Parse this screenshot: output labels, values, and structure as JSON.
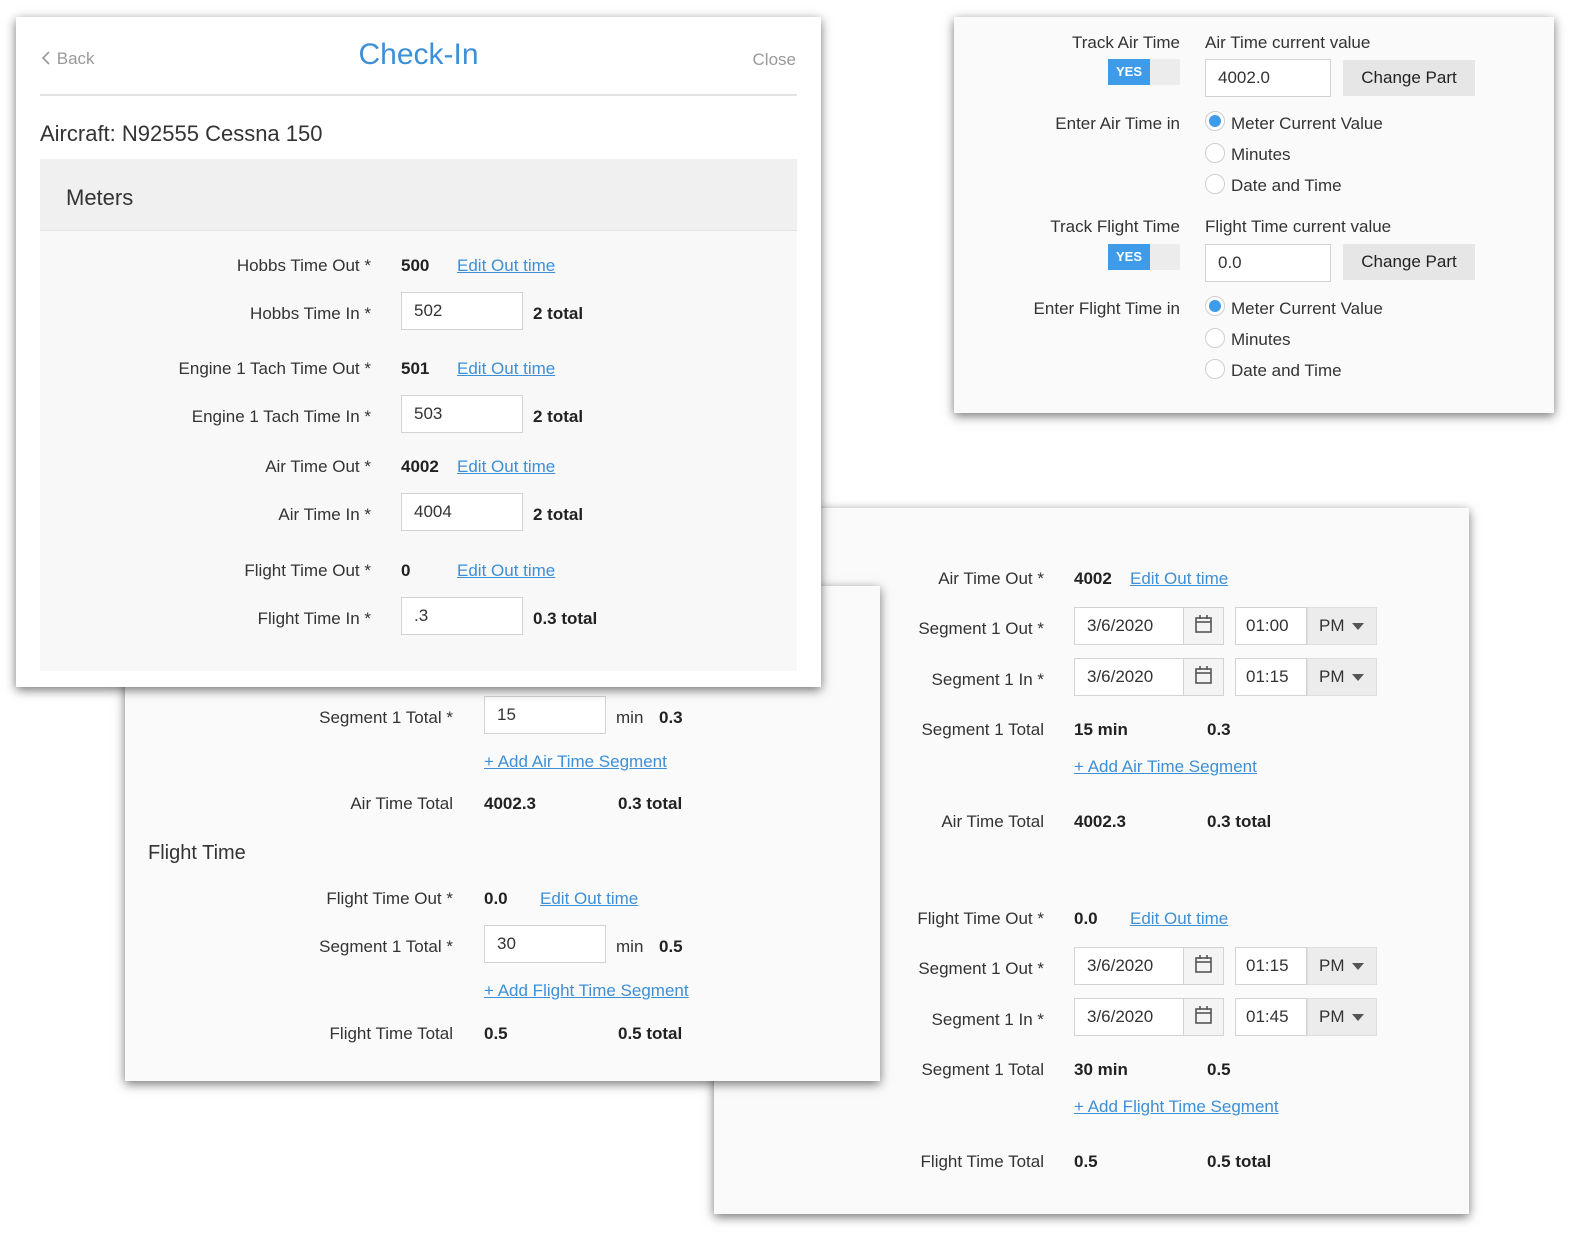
{
  "checkin": {
    "back": "Back",
    "title": "Check-In",
    "close": "Close",
    "aircraft": "Aircraft: N92555 Cessna 150",
    "section": "Meters",
    "rows": {
      "hobbs_out_label": "Hobbs Time Out *",
      "hobbs_out_value": "500",
      "hobbs_in_label": "Hobbs Time In *",
      "hobbs_in_value": "502",
      "hobbs_total": "2 total",
      "tach_out_label": "Engine 1 Tach Time Out *",
      "tach_out_value": "501",
      "tach_in_label": "Engine 1 Tach Time In *",
      "tach_in_value": "503",
      "tach_total": "2 total",
      "air_out_label": "Air Time Out *",
      "air_out_value": "4002",
      "air_in_label": "Air Time In *",
      "air_in_value": "4004",
      "air_total": "2 total",
      "flight_out_label": "Flight Time Out *",
      "flight_out_value": "0",
      "flight_in_label": "Flight Time In *",
      "flight_in_value": ".3",
      "flight_total": "0.3 total"
    },
    "edit_out": "Edit Out time"
  },
  "settings": {
    "track_air_label": "Track Air Time",
    "air_current_label": "Air Time current value",
    "toggle_yes": "YES",
    "air_current_value": "4002.0",
    "change_part": "Change Part",
    "enter_air_label": "Enter Air Time in",
    "options": [
      "Meter Current Value",
      "Minutes",
      "Date and Time"
    ],
    "track_flight_label": "Track Flight Time",
    "flight_current_label": "Flight Time current value",
    "flight_current_value": "0.0",
    "enter_flight_label": "Enter Flight Time in"
  },
  "minutes_panel": {
    "seg1_total_label": "Segment 1 Total *",
    "air_seg_value": "15",
    "min": "min",
    "air_seg_hours": "0.3",
    "add_air": "+ Add Air Time Segment",
    "air_total_label": "Air Time Total",
    "air_total_value": "4002.3",
    "air_total_sum": "0.3 total",
    "flight_section": "Flight Time",
    "flight_out_label": "Flight Time Out *",
    "flight_out_value": "0.0",
    "edit_out": "Edit Out time",
    "flight_seg_value": "30",
    "flight_seg_hours": "0.5",
    "add_flight": "+ Add Flight Time Segment",
    "flight_total_label": "Flight Time Total",
    "flight_total_value": "0.5",
    "flight_total_sum": "0.5 total"
  },
  "datetime_panel": {
    "air_out_label": "Air Time Out *",
    "air_out_value": "4002",
    "edit_out": "Edit Out time",
    "seg1_out_label": "Segment 1 Out *",
    "seg1_in_label": "Segment 1 In *",
    "seg1_total_label": "Segment 1 Total",
    "date": "3/6/2020",
    "pm": "PM",
    "air_seg_out_time": "01:00",
    "air_seg_in_time": "01:15",
    "air_seg_total": "15 min",
    "air_seg_hours": "0.3",
    "add_air": "+ Add Air Time Segment",
    "air_total_label": "Air Time Total",
    "air_total_value": "4002.3",
    "air_total_sum": "0.3 total",
    "flight_out_label": "Flight Time Out *",
    "flight_out_value": "0.0",
    "flight_seg_out_time": "01:15",
    "flight_seg_in_time": "01:45",
    "flight_seg_total": "30 min",
    "flight_seg_hours": "0.5",
    "add_flight": "+ Add Flight Time Segment",
    "flight_total_label": "Flight Time Total",
    "flight_total_value": "0.5",
    "flight_total_sum": "0.5 total"
  },
  "colors": {
    "accent": "#3d8fd6",
    "toggle_on": "#3d9be9",
    "button_bg": "#e6e6e6"
  }
}
